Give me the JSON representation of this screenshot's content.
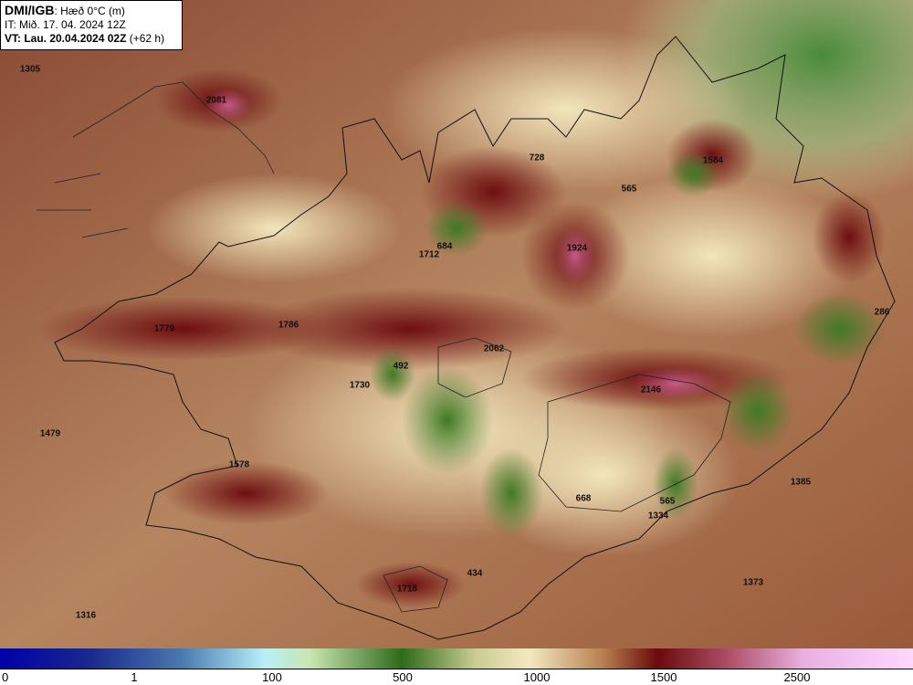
{
  "header": {
    "brand": "DMI/IGB",
    "variable": ": Hæð 0°C (m)",
    "issue_time": "IT: Mið. 17. 04. 2024 12Z",
    "valid_time": "VT: Lau. 20.04.2024 02Z",
    "lead": "(+62 h)"
  },
  "map_labels": [
    "1305",
    "2081",
    "728",
    "1584",
    "565",
    "684",
    "1712",
    "1924",
    "286",
    "1779",
    "1786",
    "2062",
    "492",
    "1730",
    "2146",
    "1479",
    "1578",
    "668",
    "565",
    "1334",
    "1385",
    "434",
    "1718",
    "1373",
    "1316"
  ],
  "colorbar": {
    "ticks": [
      "0",
      "1",
      "100",
      "500",
      "1000",
      "1500",
      "2500"
    ]
  },
  "colors": {
    "land_dark": "#7a1a14",
    "land_mid": "#b07a50",
    "land_light": "#f0e4b8",
    "low_green": "#3a7a2a",
    "high_pink": "#c05a80"
  }
}
